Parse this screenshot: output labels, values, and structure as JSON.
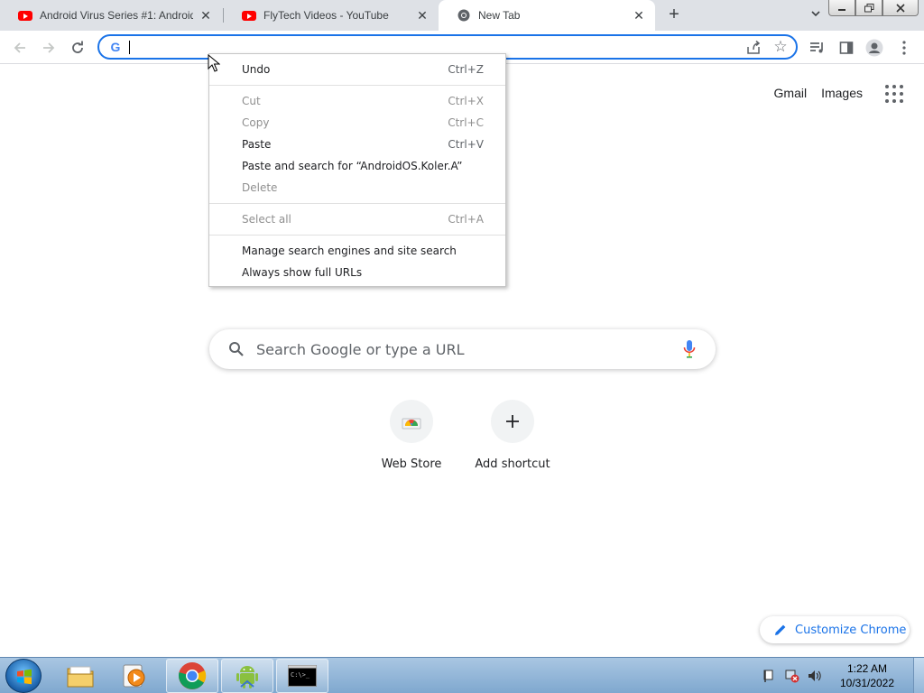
{
  "tabs": [
    {
      "title": "Android Virus Series #1: Android",
      "favicon": "youtube-icon",
      "active": false
    },
    {
      "title": "FlyTech Videos - YouTube",
      "favicon": "youtube-icon",
      "active": false
    },
    {
      "title": "New Tab",
      "favicon": "chrome-icon",
      "active": true
    }
  ],
  "omnibox": {
    "value": "",
    "placeholder": ""
  },
  "ntp": {
    "links": {
      "gmail": "Gmail",
      "images": "Images"
    },
    "search_placeholder": "Search Google or type a URL",
    "shortcuts": [
      {
        "label": "Web Store",
        "icon": "web-store-icon"
      },
      {
        "label": "Add shortcut",
        "icon": "plus-icon"
      }
    ],
    "customize_label": "Customize Chrome"
  },
  "context_menu": {
    "items": [
      {
        "label": "Undo",
        "shortcut": "Ctrl+Z",
        "enabled": true
      },
      {
        "label": "Cut",
        "shortcut": "Ctrl+X",
        "enabled": false
      },
      {
        "label": "Copy",
        "shortcut": "Ctrl+C",
        "enabled": false
      },
      {
        "label": "Paste",
        "shortcut": "Ctrl+V",
        "enabled": true
      },
      {
        "label": "Paste and search for “AndroidOS.Koler.A”",
        "shortcut": "",
        "enabled": true
      },
      {
        "label": "Delete",
        "shortcut": "",
        "enabled": false
      },
      {
        "label": "Select all",
        "shortcut": "Ctrl+A",
        "enabled": false
      },
      {
        "label": "Manage search engines and site search",
        "shortcut": "",
        "enabled": true
      },
      {
        "label": "Always show full URLs",
        "shortcut": "",
        "enabled": true
      }
    ]
  },
  "taskbar": {
    "pinned": [
      {
        "name": "windows-explorer",
        "icon": "folder-icon"
      },
      {
        "name": "media-player",
        "icon": "media-player-icon"
      },
      {
        "name": "chrome",
        "icon": "chrome-icon"
      },
      {
        "name": "android-emulator",
        "icon": "android-icon"
      },
      {
        "name": "command-prompt",
        "icon": "cmd-icon"
      }
    ],
    "cmd_text": "C:\\>_",
    "clock": {
      "time": "1:22 AM",
      "date": "10/31/2022"
    }
  },
  "colors": {
    "accent": "#1a73e8",
    "youtube_red": "#ff0000",
    "tabstrip": "#dee1e6"
  }
}
